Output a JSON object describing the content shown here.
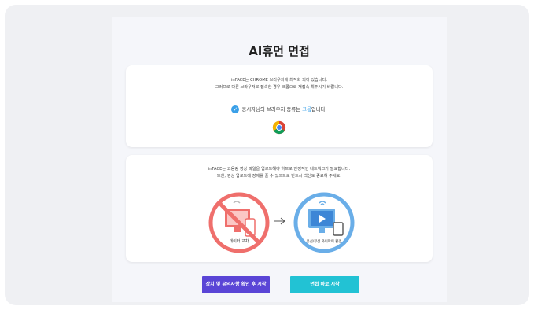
{
  "page": {
    "title": "AI휴먼 면접"
  },
  "browser_card": {
    "line1": "inFACE는 CHROME 브라우저에 최적화 되어 있습니다.",
    "line2": "그러므로 다른 브라우저로 접속한 경우 크롬으로 재접속 해주시기 바랍니다.",
    "status_prefix": "응시자님의 브라우저 종류는 ",
    "status_browser": "크롬",
    "status_suffix": "입니다.",
    "browser_icon": "chrome-icon"
  },
  "network_card": {
    "line1": "inFACE는 고용량 영상 파일을 업로드해야 하므로 안정적인 네트워크가 필요합니다.",
    "line2": "또한, 영상 업로드에 장애를 줄 수 있으므로 반드시 백신도 종료해 주세요.",
    "bad_label": "데이터 교차",
    "good_label": "유선/무선 와이파이 환경",
    "bad_icon": "no-mobile-data-icon",
    "good_icon": "wifi-computer-icon"
  },
  "buttons": {
    "check_label": "장치 및 유의사항 확인 후 시작",
    "start_label": "면접 바로 시작"
  },
  "colors": {
    "primary_purple": "#5a45d6",
    "primary_teal": "#22c2d4",
    "accent_blue": "#3aa0e8",
    "bad_red": "#ef6f6c",
    "good_blue": "#6aaee8"
  }
}
